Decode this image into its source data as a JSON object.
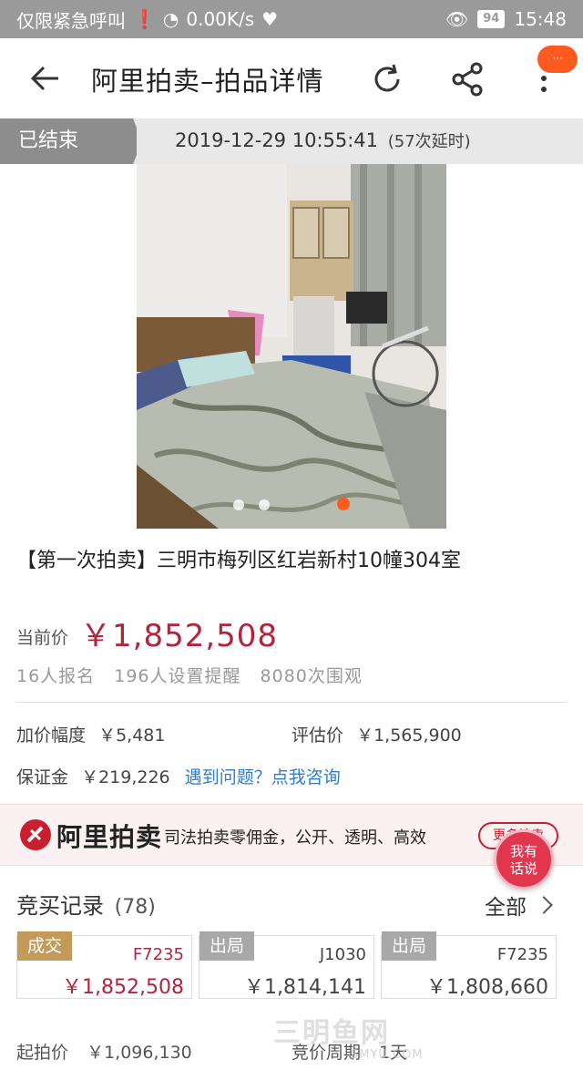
{
  "status_bar": {
    "carrier": "仅限紧急呼叫",
    "speed": "0.00K/s",
    "battery": "94",
    "time": "15:48"
  },
  "header": {
    "title": "阿里拍卖–拍品详情",
    "more_badge": "···"
  },
  "auction_status": {
    "state": "已结束",
    "end_time": "2019-12-29 10:55:41",
    "extensions": "(57次延时)"
  },
  "item": {
    "title": "【第一次拍卖】三明市梅列区红岩新村10幢304室",
    "price_label": "当前价",
    "price": "￥1,852,508",
    "stats": {
      "signups": "16人报名",
      "reminders": "196人设置提醒",
      "views": "8080次围观"
    }
  },
  "details": {
    "increment_label": "加价幅度",
    "increment_value": "￥5,481",
    "appraisal_label": "评估价",
    "appraisal_value": "￥1,565,900",
    "deposit_label": "保证金",
    "deposit_value": "￥219,226",
    "help_link": "遇到问题？点我咨询"
  },
  "banner": {
    "brand": "阿里拍卖",
    "slogan": "司法拍卖零佣金，公开、透明、高效",
    "more_button": "更多拍卖"
  },
  "chat_button": {
    "line1": "我有",
    "line2": "话说"
  },
  "bid_records": {
    "title": "竞买记录",
    "count": "(78)",
    "all_label": "全部",
    "items": [
      {
        "tag": "成交",
        "bidder": "F7235",
        "amount": "￥1,852,508",
        "color": "#b0253d"
      },
      {
        "tag": "出局",
        "bidder": "J1030",
        "amount": "￥1,814,141",
        "color": "#444444"
      },
      {
        "tag": "出局",
        "bidder": "F7235",
        "amount": "￥1,808,660",
        "color": "#444444"
      }
    ]
  },
  "bottom": {
    "start_label": "起拍价",
    "start_value": "￥1,096,130",
    "cycle_label": "竞价周期",
    "cycle_value": "1天"
  },
  "watermark": {
    "text": "三明鱼网",
    "sub": "SMYU.COM"
  }
}
